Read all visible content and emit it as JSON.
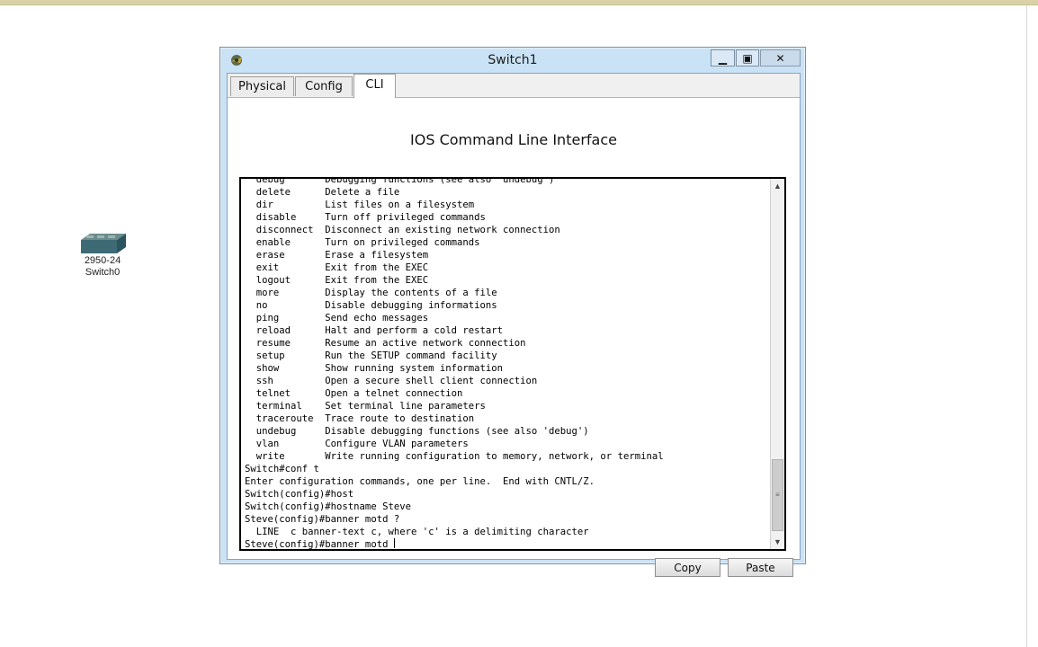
{
  "window": {
    "title": "Switch1",
    "minimize_glyph": "▁",
    "maximize_glyph": "▣",
    "close_glyph": "✕"
  },
  "tabs": [
    {
      "label": "Physical"
    },
    {
      "label": "Config"
    },
    {
      "label": "CLI"
    }
  ],
  "cli": {
    "heading": "IOS Command Line Interface",
    "lines": [
      "  debug       Debugging functions (see also 'undebug')",
      "  delete      Delete a file",
      "  dir         List files on a filesystem",
      "  disable     Turn off privileged commands",
      "  disconnect  Disconnect an existing network connection",
      "  enable      Turn on privileged commands",
      "  erase       Erase a filesystem",
      "  exit        Exit from the EXEC",
      "  logout      Exit from the EXEC",
      "  more        Display the contents of a file",
      "  no          Disable debugging informations",
      "  ping        Send echo messages",
      "  reload      Halt and perform a cold restart",
      "  resume      Resume an active network connection",
      "  setup       Run the SETUP command facility",
      "  show        Show running system information",
      "  ssh         Open a secure shell client connection",
      "  telnet      Open a telnet connection",
      "  terminal    Set terminal line parameters",
      "  traceroute  Trace route to destination",
      "  undebug     Disable debugging functions (see also 'debug')",
      "  vlan        Configure VLAN parameters",
      "  write       Write running configuration to memory, network, or terminal",
      "Switch#conf t",
      "Enter configuration commands, one per line.  End with CNTL/Z.",
      "Switch(config)#host",
      "Switch(config)#hostname Steve",
      "Steve(config)#banner motd ?",
      "  LINE  c banner-text c, where 'c' is a delimiting character"
    ],
    "prompt_line": "Steve(config)#banner motd "
  },
  "buttons": {
    "copy": "Copy",
    "paste": "Paste"
  },
  "device": {
    "model": "2950-24",
    "name": "Switch0",
    "icon": "switch-icon"
  },
  "colors": {
    "window_frame": "#c9e2f5",
    "terminal_bg": "#ffffff",
    "terminal_text": "#000000",
    "top_strip": "#d9d2a8"
  }
}
